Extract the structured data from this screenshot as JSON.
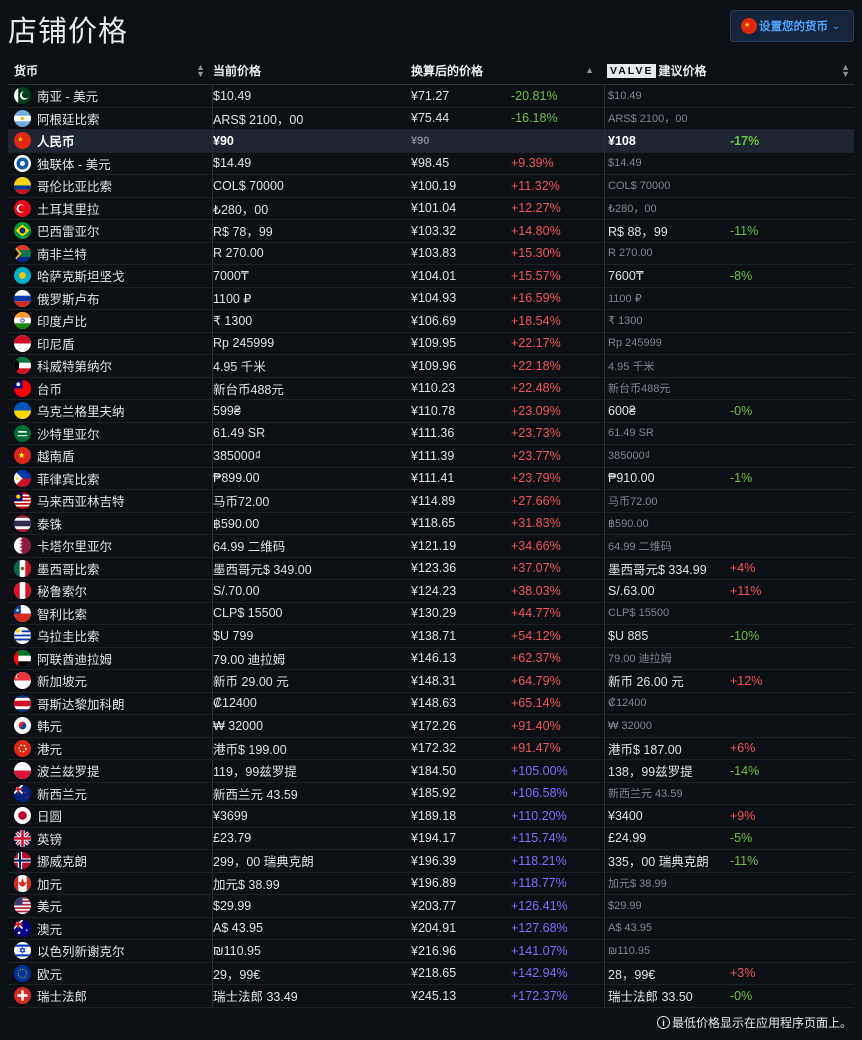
{
  "title": "店铺价格",
  "currency_selector": {
    "label": "设置您的货币",
    "flag": "cn",
    "chevron": "chevron-down-icon"
  },
  "headers": {
    "currency": "货币",
    "current_price": "当前价格",
    "converted_price": "换算后的价格",
    "valve_logo": "VALVE",
    "recommended_price": "建议价格"
  },
  "colors": {
    "increase": "#f2545b",
    "decrease": "#6ec143",
    "over_100": "#7c71ff",
    "highlight_row": "#1d2631",
    "accent": "#4fa3ff"
  },
  "rows": [
    {
      "flag": "pk",
      "currency": "南亚 - 美元",
      "price": "$10.49",
      "converted": "¥71.27",
      "diff": "-20.81%",
      "rec": "$10.49",
      "rec_diff": ""
    },
    {
      "flag": "ar",
      "currency": "阿根廷比索",
      "price": "ARS$ 2100，00",
      "converted": "¥75.44",
      "diff": "-16.18%",
      "rec": "ARS$ 2100，00",
      "rec_diff": ""
    },
    {
      "flag": "cn",
      "currency": "人民币",
      "price": "¥90",
      "converted": "¥90",
      "diff": "",
      "rec": "¥108",
      "rec_diff": "-17%",
      "highlight": true
    },
    {
      "flag": "cis",
      "currency": "独联体 - 美元",
      "price": "$14.49",
      "converted": "¥98.45",
      "diff": "+9.39%",
      "rec": "$14.49",
      "rec_diff": ""
    },
    {
      "flag": "co",
      "currency": "哥伦比亚比索",
      "price": "COL$ 70000",
      "converted": "¥100.19",
      "diff": "+11.32%",
      "rec": "COL$ 70000",
      "rec_diff": ""
    },
    {
      "flag": "tr",
      "currency": "土耳其里拉",
      "price": "₺280，00",
      "converted": "¥101.04",
      "diff": "+12.27%",
      "rec": "₺280，00",
      "rec_diff": ""
    },
    {
      "flag": "br",
      "currency": "巴西雷亚尔",
      "price": "R$ 78，99",
      "converted": "¥103.32",
      "diff": "+14.80%",
      "rec": "R$ 88，99",
      "rec_diff": "-11%"
    },
    {
      "flag": "za",
      "currency": "南非兰特",
      "price": "R 270.00",
      "converted": "¥103.83",
      "diff": "+15.30%",
      "rec": "R 270.00",
      "rec_diff": ""
    },
    {
      "flag": "kz",
      "currency": "哈萨克斯坦坚戈",
      "price": "7000₸",
      "converted": "¥104.01",
      "diff": "+15.57%",
      "rec": "7600₸",
      "rec_diff": "-8%"
    },
    {
      "flag": "ru",
      "currency": "俄罗斯卢布",
      "price": "1100 ₽",
      "converted": "¥104.93",
      "diff": "+16.59%",
      "rec": "1100 ₽",
      "rec_diff": ""
    },
    {
      "flag": "in",
      "currency": "印度卢比",
      "price": "₹ 1300",
      "converted": "¥106.69",
      "diff": "+18.54%",
      "rec": "₹ 1300",
      "rec_diff": ""
    },
    {
      "flag": "id",
      "currency": "印尼盾",
      "price": "Rp 245999",
      "converted": "¥109.95",
      "diff": "+22.17%",
      "rec": "Rp 245999",
      "rec_diff": ""
    },
    {
      "flag": "kw",
      "currency": "科威特第纳尔",
      "price": "4.95 千米",
      "converted": "¥109.96",
      "diff": "+22.18%",
      "rec": "4.95 千米",
      "rec_diff": ""
    },
    {
      "flag": "tw",
      "currency": "台币",
      "price": "新台币488元",
      "converted": "¥110.23",
      "diff": "+22.48%",
      "rec": "新台币488元",
      "rec_diff": ""
    },
    {
      "flag": "ua",
      "currency": "乌克兰格里夫纳",
      "price": "599₴",
      "converted": "¥110.78",
      "diff": "+23.09%",
      "rec": "600₴",
      "rec_diff": "-0%"
    },
    {
      "flag": "sa",
      "currency": "沙特里亚尔",
      "price": "61.49 SR",
      "converted": "¥111.36",
      "diff": "+23.73%",
      "rec": "61.49 SR",
      "rec_diff": ""
    },
    {
      "flag": "vn",
      "currency": "越南盾",
      "price": "385000₫",
      "converted": "¥111.39",
      "diff": "+23.77%",
      "rec": "385000₫",
      "rec_diff": ""
    },
    {
      "flag": "ph",
      "currency": "菲律宾比索",
      "price": "₱899.00",
      "converted": "¥111.41",
      "diff": "+23.79%",
      "rec": "₱910.00",
      "rec_diff": "-1%"
    },
    {
      "flag": "my",
      "currency": "马来西亚林吉特",
      "price": "马币72.00",
      "converted": "¥114.89",
      "diff": "+27.66%",
      "rec": "马币72.00",
      "rec_diff": ""
    },
    {
      "flag": "th",
      "currency": "泰铢",
      "price": "฿590.00",
      "converted": "¥118.65",
      "diff": "+31.83%",
      "rec": "฿590.00",
      "rec_diff": ""
    },
    {
      "flag": "qa",
      "currency": "卡塔尔里亚尔",
      "price": "64.99 二维码",
      "converted": "¥121.19",
      "diff": "+34.66%",
      "rec": "64.99 二维码",
      "rec_diff": ""
    },
    {
      "flag": "mx",
      "currency": "墨西哥比索",
      "price": "墨西哥元$ 349.00",
      "converted": "¥123.36",
      "diff": "+37.07%",
      "rec": "墨西哥元$ 334.99",
      "rec_diff": "+4%"
    },
    {
      "flag": "pe",
      "currency": "秘鲁索尔",
      "price": "S/.70.00",
      "converted": "¥124.23",
      "diff": "+38.03%",
      "rec": "S/.63.00",
      "rec_diff": "+11%"
    },
    {
      "flag": "cl",
      "currency": "智利比索",
      "price": "CLP$ 15500",
      "converted": "¥130.29",
      "diff": "+44.77%",
      "rec": "CLP$ 15500",
      "rec_diff": ""
    },
    {
      "flag": "uy",
      "currency": "乌拉圭比索",
      "price": "$U 799",
      "converted": "¥138.71",
      "diff": "+54.12%",
      "rec": "$U 885",
      "rec_diff": "-10%"
    },
    {
      "flag": "ae",
      "currency": "阿联酋迪拉姆",
      "price": "79.00 迪拉姆",
      "converted": "¥146.13",
      "diff": "+62.37%",
      "rec": "79.00 迪拉姆",
      "rec_diff": ""
    },
    {
      "flag": "sg",
      "currency": "新加坡元",
      "price": "新币 29.00 元",
      "converted": "¥148.31",
      "diff": "+64.79%",
      "rec": "新币 26.00 元",
      "rec_diff": "+12%"
    },
    {
      "flag": "cr",
      "currency": "哥斯达黎加科朗",
      "price": "₡12400",
      "converted": "¥148.63",
      "diff": "+65.14%",
      "rec": "₡12400",
      "rec_diff": ""
    },
    {
      "flag": "kr",
      "currency": "韩元",
      "price": "₩ 32000",
      "converted": "¥172.26",
      "diff": "+91.40%",
      "rec": "₩ 32000",
      "rec_diff": ""
    },
    {
      "flag": "hk",
      "currency": "港元",
      "price": "港币$ 199.00",
      "converted": "¥172.32",
      "diff": "+91.47%",
      "rec": "港币$ 187.00",
      "rec_diff": "+6%"
    },
    {
      "flag": "pl",
      "currency": "波兰兹罗提",
      "price": "119，99兹罗提",
      "converted": "¥184.50",
      "diff": "+105.00%",
      "rec": "138，99兹罗提",
      "rec_diff": "-14%"
    },
    {
      "flag": "nz",
      "currency": "新西兰元",
      "price": "新西兰元 43.59",
      "converted": "¥185.92",
      "diff": "+106.58%",
      "rec": "新西兰元 43.59",
      "rec_diff": ""
    },
    {
      "flag": "jp",
      "currency": "日圆",
      "price": "¥3699",
      "converted": "¥189.18",
      "diff": "+110.20%",
      "rec": "¥3400",
      "rec_diff": "+9%"
    },
    {
      "flag": "gb",
      "currency": "英镑",
      "price": "£23.79",
      "converted": "¥194.17",
      "diff": "+115.74%",
      "rec": "£24.99",
      "rec_diff": "-5%"
    },
    {
      "flag": "no",
      "currency": "挪威克朗",
      "price": "299，00 瑞典克朗",
      "converted": "¥196.39",
      "diff": "+118.21%",
      "rec": "335，00 瑞典克朗",
      "rec_diff": "-11%"
    },
    {
      "flag": "ca",
      "currency": "加元",
      "price": "加元$ 38.99",
      "converted": "¥196.89",
      "diff": "+118.77%",
      "rec": "加元$ 38.99",
      "rec_diff": ""
    },
    {
      "flag": "us",
      "currency": "美元",
      "price": "$29.99",
      "converted": "¥203.77",
      "diff": "+126.41%",
      "rec": "$29.99",
      "rec_diff": ""
    },
    {
      "flag": "au",
      "currency": "澳元",
      "price": "A$ 43.95",
      "converted": "¥204.91",
      "diff": "+127.68%",
      "rec": "A$ 43.95",
      "rec_diff": ""
    },
    {
      "flag": "il",
      "currency": "以色列新谢克尔",
      "price": "₪110.95",
      "converted": "¥216.96",
      "diff": "+141.07%",
      "rec": "₪110.95",
      "rec_diff": ""
    },
    {
      "flag": "eu",
      "currency": "欧元",
      "price": "29，99€",
      "converted": "¥218.65",
      "diff": "+142.94%",
      "rec": "28，99€",
      "rec_diff": "+3%"
    },
    {
      "flag": "ch",
      "currency": "瑞士法郎",
      "price": "瑞士法郎 33.49",
      "converted": "¥245.13",
      "diff": "+172.37%",
      "rec": "瑞士法郎 33.50",
      "rec_diff": "-0%"
    }
  ],
  "footer": {
    "icon": "info-icon",
    "text": "最低价格显示在应用程序页面上。"
  }
}
